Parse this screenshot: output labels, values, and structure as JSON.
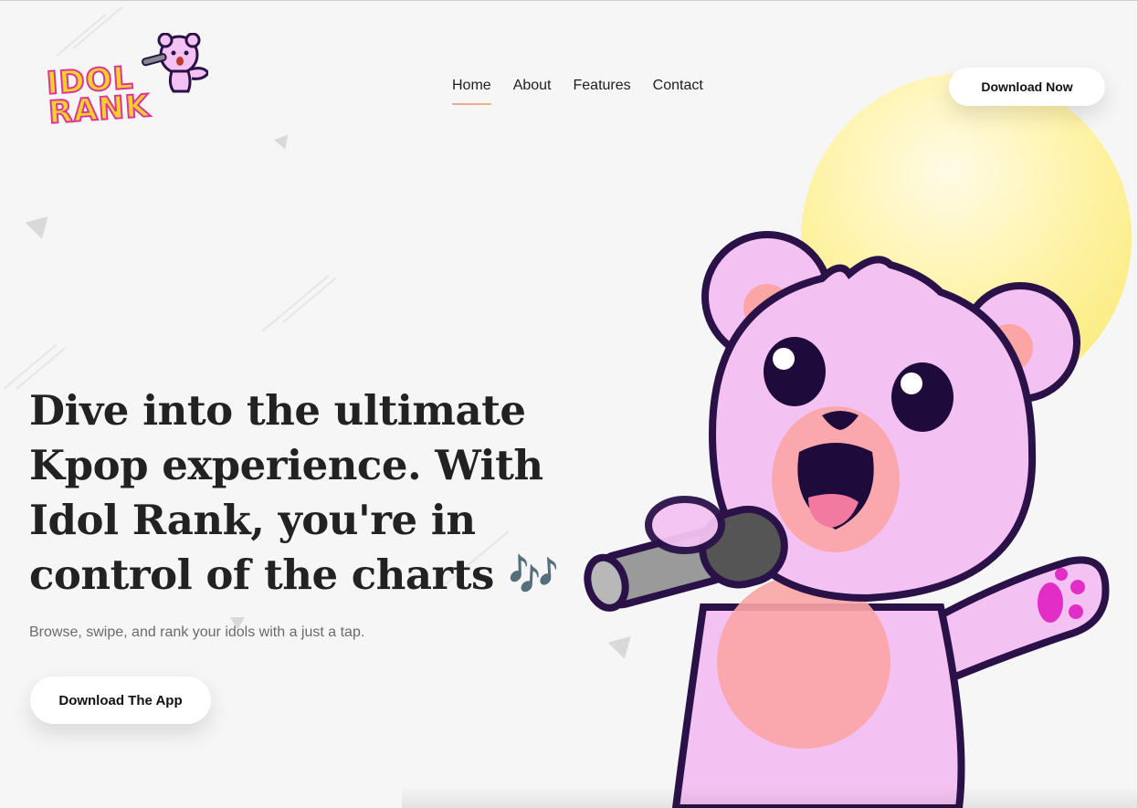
{
  "brand": {
    "logo_line1": "IDOL",
    "logo_line2": "RANK"
  },
  "nav": {
    "items": [
      {
        "label": "Home",
        "active": true
      },
      {
        "label": "About",
        "active": false
      },
      {
        "label": "Features",
        "active": false
      },
      {
        "label": "Contact",
        "active": false
      }
    ]
  },
  "header": {
    "cta_label": "Download Now"
  },
  "hero": {
    "title": "Dive into the ultimate Kpop experience. With Idol Rank, you're in control of the charts 🎶",
    "subtitle": "Browse, swipe, and rank your idols with a just a tap.",
    "cta_label": "Download The App"
  },
  "colors": {
    "background": "#f6f6f6",
    "sun": "#f7e86a",
    "bear_body": "#f4c2f2",
    "bear_outline": "#2a1248",
    "nav_underline": "#f4a0a0"
  },
  "icons": [
    "bear-mascot-illustration",
    "microphone-icon",
    "music-notes-emoji"
  ]
}
